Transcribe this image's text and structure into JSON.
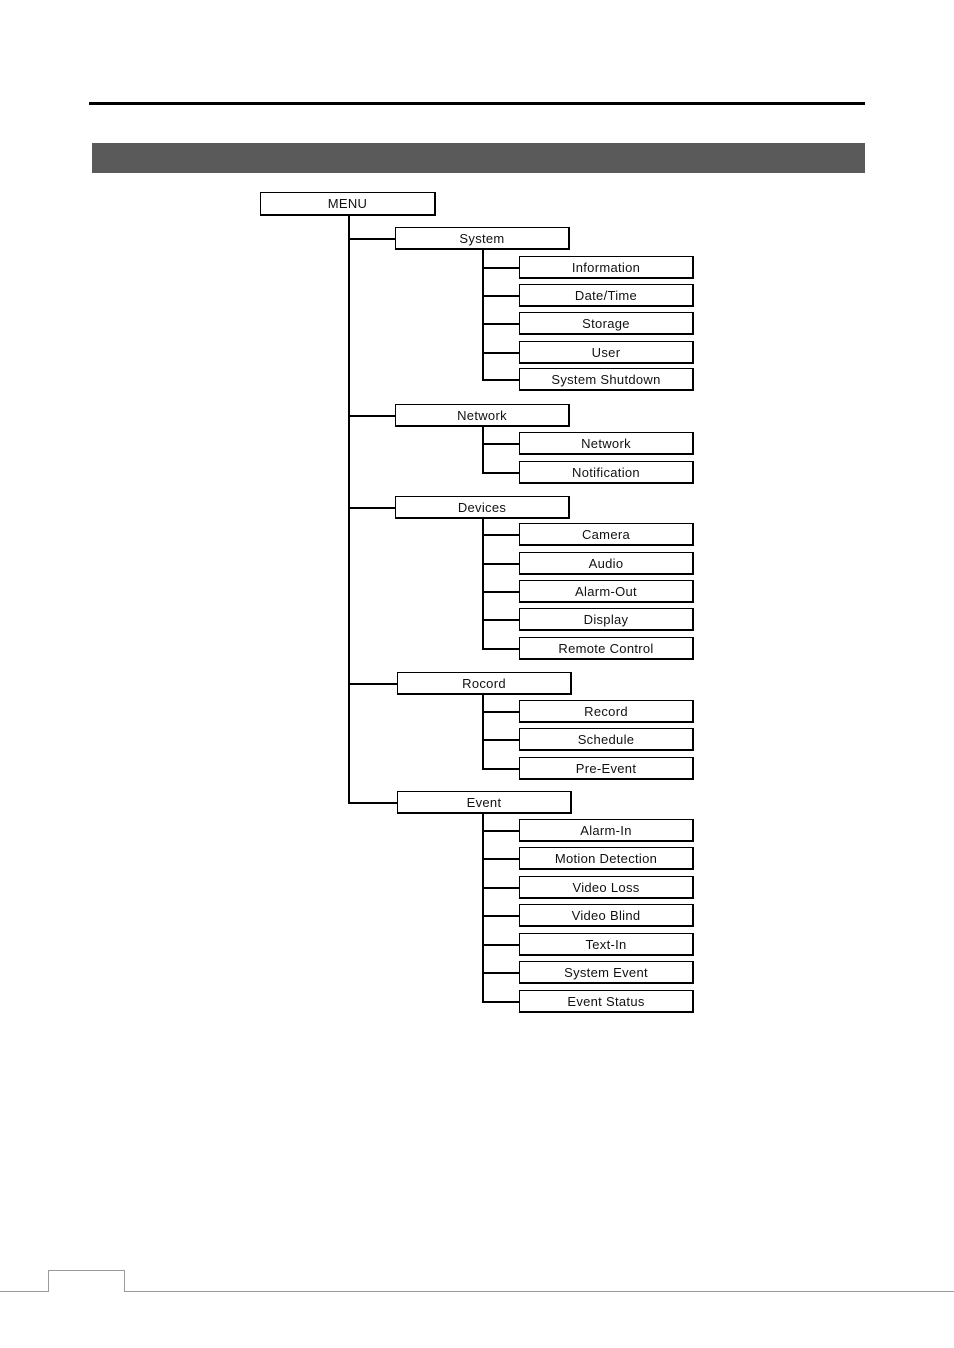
{
  "diagram": {
    "root": "MENU",
    "branches": [
      {
        "label": "System",
        "children": [
          "Information",
          "Date/Time",
          "Storage",
          "User",
          "System Shutdown"
        ]
      },
      {
        "label": "Network",
        "children": [
          "Network",
          "Notification"
        ]
      },
      {
        "label": "Devices",
        "children": [
          "Camera",
          "Audio",
          "Alarm-Out",
          "Display",
          "Remote Control"
        ]
      },
      {
        "label": "Rocord",
        "children": [
          "Record",
          "Schedule",
          "Pre-Event"
        ]
      },
      {
        "label": "Event",
        "children": [
          "Alarm-In",
          "Motion Detection",
          "Video Loss",
          "Video Blind",
          "Text-In",
          "System Event",
          "Event Status"
        ]
      }
    ]
  },
  "colors": {
    "section_bar": "#5a5a5a",
    "line": "#000000",
    "footer": "#9a9a9a"
  }
}
